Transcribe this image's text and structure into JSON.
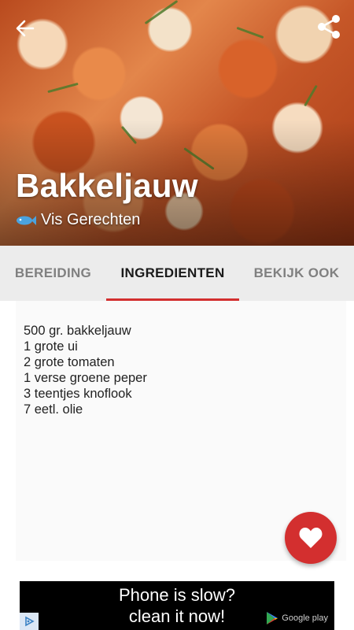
{
  "header": {
    "title": "Bakkeljauw",
    "category": "Vis Gerechten",
    "back_icon": "arrow-back-icon",
    "share_icon": "share-icon",
    "category_icon": "fish-icon"
  },
  "tabs": [
    {
      "label": "BEREIDING",
      "active": false
    },
    {
      "label": "INGREDIENTEN",
      "active": true
    },
    {
      "label": "BEKIJK OOK",
      "active": false
    }
  ],
  "ingredients": [
    "500 gr. bakkeljauw",
    "1 grote ui",
    "2 grote tomaten",
    "1 verse groene peper",
    "3 teentjes knoflook",
    "7 eetl. olie"
  ],
  "fab": {
    "icon": "heart-icon"
  },
  "ad": {
    "line1": "Phone is slow?",
    "line2": "clean it now!",
    "store_label": "Google play"
  },
  "colors": {
    "accent": "#d32f2f",
    "tab_bar": "#ececec",
    "active_tab_text": "#1a1a1a",
    "inactive_tab_text": "#808080"
  }
}
